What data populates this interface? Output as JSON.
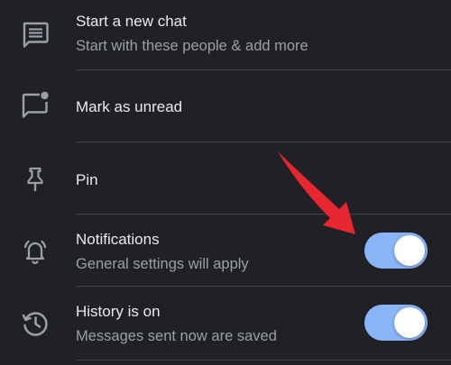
{
  "colors": {
    "background": "#202124",
    "primary_text": "#e8eaed",
    "secondary_text": "#9aa0a6",
    "divider": "#3c4043",
    "icon": "#9aa0a6",
    "toggle_track_on": "#8ab4f8",
    "toggle_knob": "#ffffff",
    "arrow": "#e8262f"
  },
  "menu": {
    "items": [
      {
        "title": "Start a new chat",
        "subtitle": "Start with these people & add more",
        "icon": "chat-bubble-icon"
      },
      {
        "title": "Mark as unread",
        "icon": "unread-chat-icon"
      },
      {
        "title": "Pin",
        "icon": "pin-icon"
      },
      {
        "title": "Notifications",
        "subtitle": "General settings will apply",
        "icon": "alarm-bell-icon",
        "toggle_on": true
      },
      {
        "title": "History is on",
        "subtitle": "Messages sent now are saved",
        "icon": "history-icon",
        "toggle_on": true
      }
    ]
  }
}
